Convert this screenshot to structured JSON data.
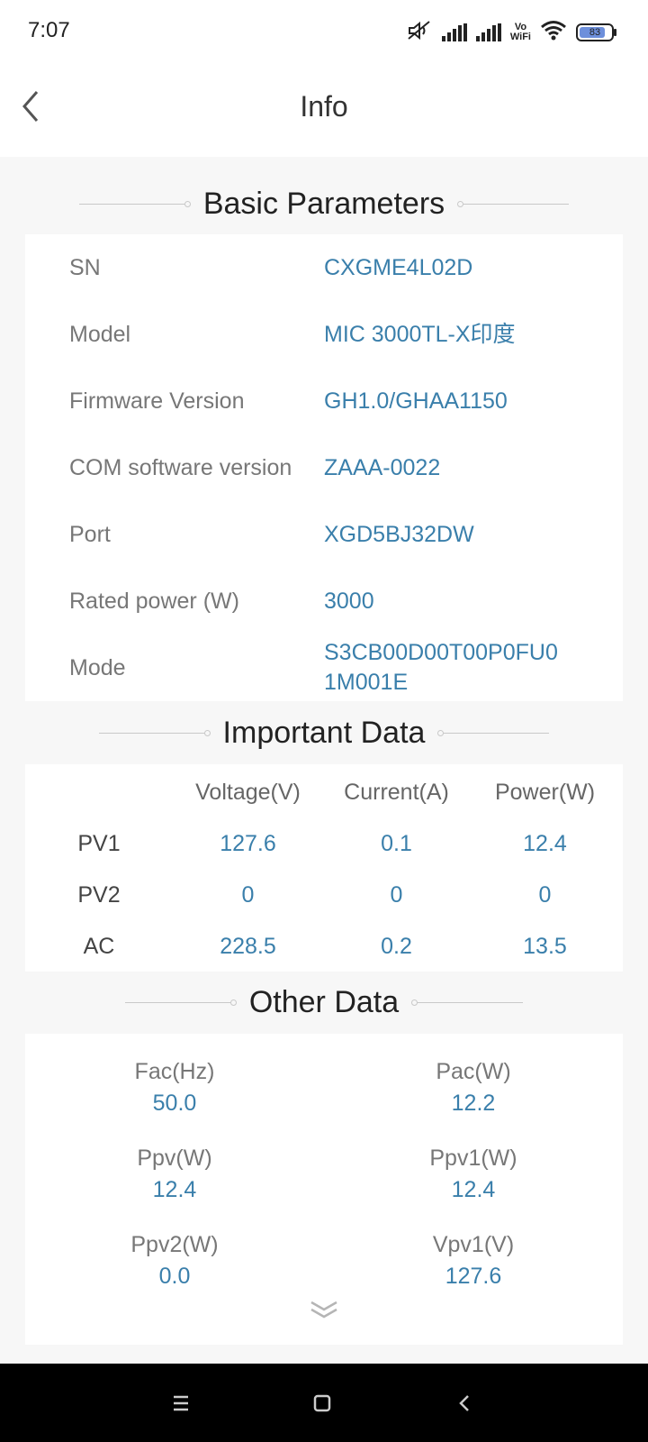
{
  "status_bar": {
    "time": "7:07",
    "vowifi_top": "Vo",
    "vowifi_bottom": "WiFi",
    "battery_level": "83",
    "icons": [
      "mute-icon",
      "signal-icon",
      "signal-icon",
      "vowifi-icon",
      "wifi-icon",
      "battery-icon"
    ]
  },
  "header": {
    "title": "Info",
    "back_icon": "chevron-left-icon"
  },
  "basic": {
    "title": "Basic Parameters",
    "rows": [
      {
        "key": "SN",
        "value": "CXGME4L02D"
      },
      {
        "key": "Model",
        "value": "MIC 3000TL-X印度"
      },
      {
        "key": "Firmware Version",
        "value": "GH1.0/GHAA1150"
      },
      {
        "key": "COM software version",
        "value": "ZAAA-0022"
      },
      {
        "key": "Port",
        "value": "XGD5BJ32DW"
      },
      {
        "key": "Rated power (W)",
        "value": "3000"
      },
      {
        "key": "Mode",
        "value": "S3CB00D00T00P0FU0\n1M001E",
        "value_line1": "S3CB00D00T00P0FU0",
        "value_line2": "1M001E"
      }
    ]
  },
  "important": {
    "title": "Important Data",
    "columns": [
      "",
      "Voltage(V)",
      "Current(A)",
      "Power(W)"
    ],
    "rows": [
      {
        "label": "PV1",
        "values": [
          "127.6",
          "0.1",
          "12.4"
        ]
      },
      {
        "label": "PV2",
        "values": [
          "0",
          "0",
          "0"
        ]
      },
      {
        "label": "AC",
        "values": [
          "228.5",
          "0.2",
          "13.5"
        ]
      }
    ]
  },
  "other": {
    "title": "Other Data",
    "items": [
      {
        "label": "Fac(Hz)",
        "value": "50.0"
      },
      {
        "label": "Pac(W)",
        "value": "12.2"
      },
      {
        "label": "Ppv(W)",
        "value": "12.4"
      },
      {
        "label": "Ppv1(W)",
        "value": "12.4"
      },
      {
        "label": "Ppv2(W)",
        "value": "0.0"
      },
      {
        "label": "Vpv1(V)",
        "value": "127.6"
      }
    ],
    "expand_icon": "double-chevron-down-icon"
  },
  "system_nav": {
    "buttons": [
      "menu-icon",
      "home-icon",
      "back-icon"
    ]
  },
  "colors": {
    "value_blue": "#3a7fab",
    "background": "#f7f7f7",
    "card": "#ffffff",
    "nav_bar": "#000000"
  }
}
